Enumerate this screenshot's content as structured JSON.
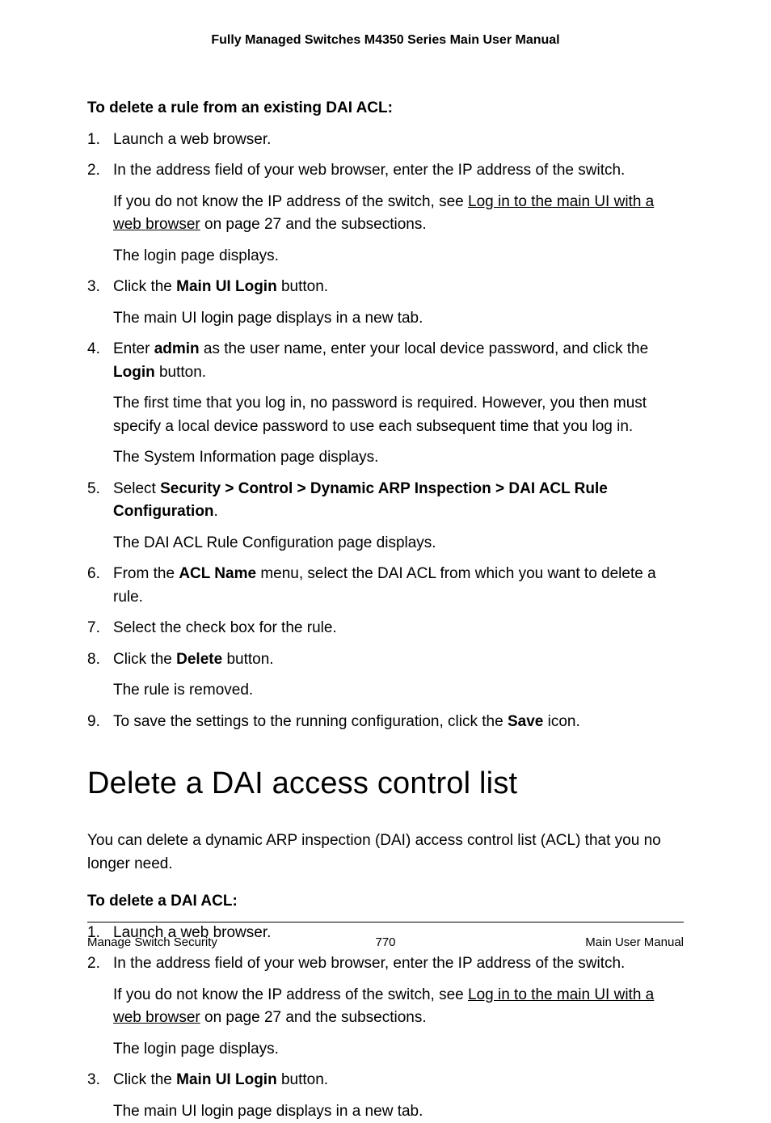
{
  "header": {
    "title": "Fully Managed Switches M4350 Series Main User Manual"
  },
  "section1": {
    "heading": "To delete a rule from an existing DAI ACL:",
    "steps": [
      {
        "p0": "Launch a web browser."
      },
      {
        "p0": "In the address field of your web browser, enter the IP address of the switch.",
        "p1a": "If you do not know the IP address of the switch, see ",
        "p1link": "Log in to the main UI with a web browser",
        "p1b": " on page 27 and the subsections.",
        "p2": "The login page displays."
      },
      {
        "p0a": "Click the ",
        "p0bold": "Main UI Login",
        "p0b": " button.",
        "p1": "The main UI login page displays in a new tab."
      },
      {
        "p0a": "Enter ",
        "p0bold1": "admin",
        "p0b": " as the user name, enter your local device password, and click the ",
        "p0bold2": "Login",
        "p0c": " button.",
        "p1": "The first time that you log in, no password is required. However, you then must specify a local device password to use each subsequent time that you log in.",
        "p2": "The System Information page displays."
      },
      {
        "p0a": "Select ",
        "p0bold": "Security > Control > Dynamic ARP Inspection > DAI ACL Rule Configuration",
        "p0b": ".",
        "p1": "The DAI ACL Rule Configuration page displays."
      },
      {
        "p0a": "From the ",
        "p0bold": "ACL Name",
        "p0b": " menu, select the DAI ACL from which you want to delete a rule."
      },
      {
        "p0": "Select the check box for the rule."
      },
      {
        "p0a": "Click the ",
        "p0bold": "Delete",
        "p0b": " button.",
        "p1": "The rule is removed."
      },
      {
        "p0a": "To save the settings to the running configuration, click the ",
        "p0bold": "Save",
        "p0b": " icon."
      }
    ]
  },
  "section2": {
    "title": "Delete a DAI access control list",
    "intro": "You can delete a dynamic ARP inspection (DAI) access control list (ACL) that you no longer need.",
    "heading": "To delete a DAI ACL:",
    "steps": [
      {
        "p0": "Launch a web browser."
      },
      {
        "p0": "In the address field of your web browser, enter the IP address of the switch.",
        "p1a": "If you do not know the IP address of the switch, see ",
        "p1link": "Log in to the main UI with a web browser",
        "p1b": " on page 27 and the subsections.",
        "p2": "The login page displays."
      },
      {
        "p0a": "Click the ",
        "p0bold": "Main UI Login",
        "p0b": " button.",
        "p1": "The main UI login page displays in a new tab."
      }
    ]
  },
  "footer": {
    "left": "Manage Switch Security",
    "center": "770",
    "right": "Main User Manual"
  }
}
